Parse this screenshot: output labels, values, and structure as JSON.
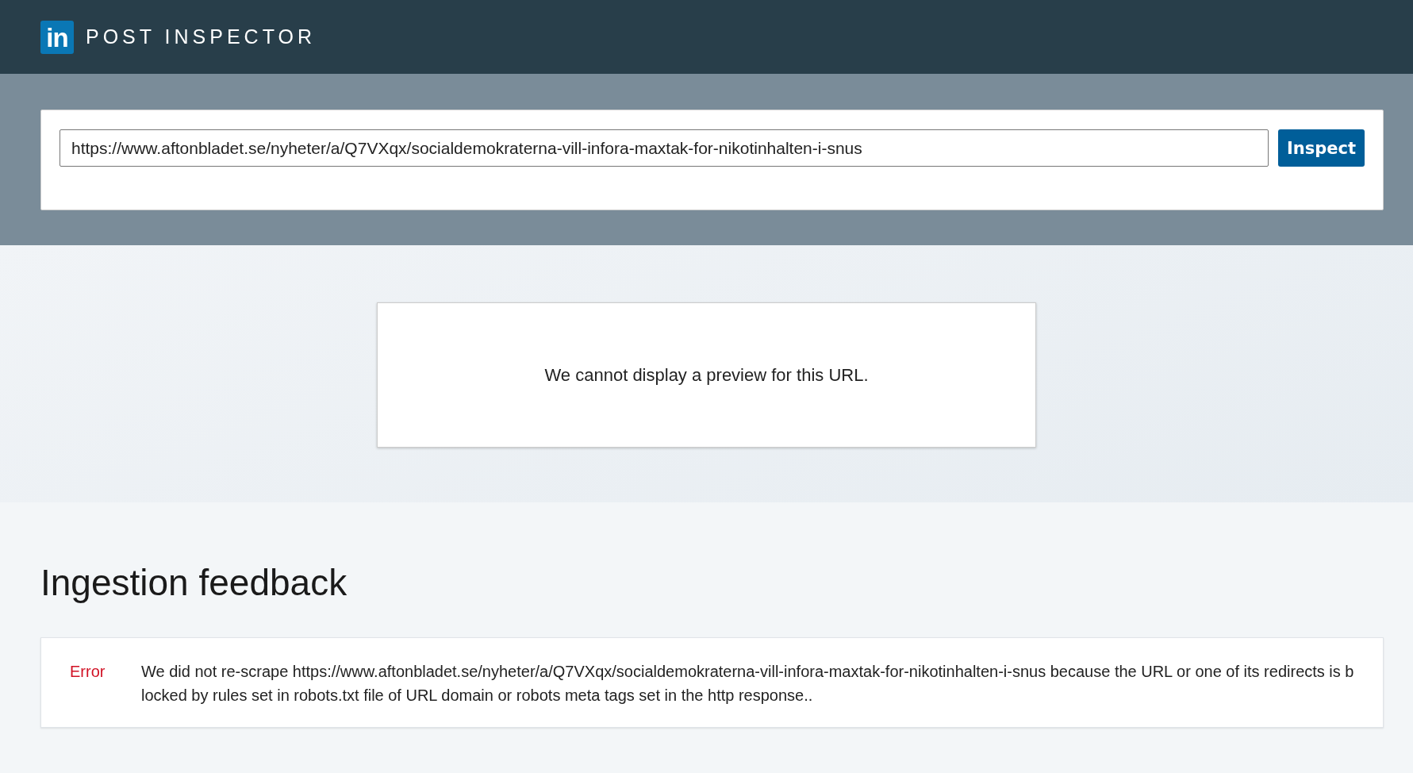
{
  "header": {
    "logo": "in",
    "title": "POST INSPECTOR"
  },
  "search": {
    "value": "https://www.aftonbladet.se/nyheter/a/Q7VXqx/socialdemokraterna-vill-infora-maxtak-for-nikotinhalten-i-snus",
    "button": "Inspect"
  },
  "preview": {
    "message": "We cannot display a preview for this URL."
  },
  "feedback": {
    "heading": "Ingestion feedback",
    "items": [
      {
        "kind": "error",
        "label": "Error",
        "message": "We did not re-scrape https://www.aftonbladet.se/nyheter/a/Q7VXqx/socialdemokraterna-vill-infora-maxtak-for-nikotinhalten-i-snus because the URL or one of its redirects is blocked by rules set in robots.txt file of URL domain or robots meta tags set in the http response.."
      }
    ]
  }
}
